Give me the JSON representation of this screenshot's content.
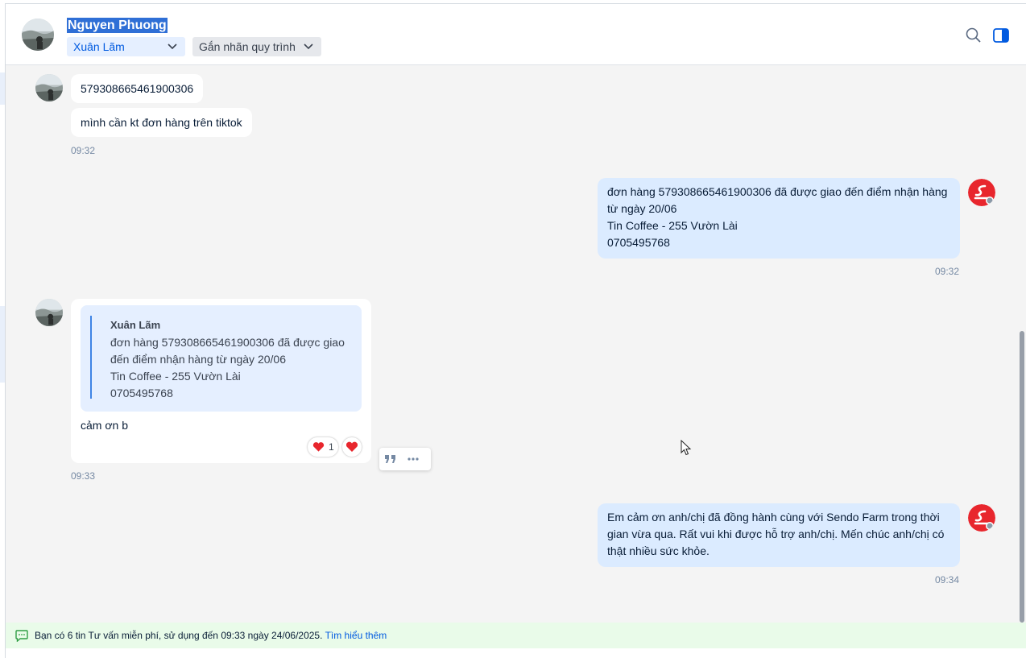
{
  "header": {
    "contact_name": "Nguyen Phuong",
    "assignee": "Xuân Lãm",
    "label_dropdown": "Gắn nhãn quy trình",
    "icons": [
      "search-icon",
      "sidebar-toggle-icon"
    ]
  },
  "messages": {
    "m1_text": "579308665461900306",
    "m2_text": "mình cần kt đơn hàng trên tiktok",
    "m2_time": "09:32",
    "m3_lines": [
      "đơn hàng 579308665461900306 đã được giao đến điểm nhận hàng",
      "từ ngày 20/06",
      "Tin Coffee - 255 Vườn Lài",
      "0705495768"
    ],
    "m3_time": "09:32",
    "m4_quote_author": "Xuân Lãm",
    "m4_quote_lines": [
      "đơn hàng 579308665461900306 đã được giao",
      "đến điểm nhận hàng từ ngày 20/06",
      "Tin Coffee - 255 Vườn Lài",
      "0705495768"
    ],
    "m4_text": "cảm ơn b",
    "m4_reaction_count": "1",
    "m4_time": "09:33",
    "m5_lines": [
      "Em cảm ơn anh/chị đã đồng hành cùng với Sendo Farm trong thời",
      "gian vừa qua. Rất vui khi được hỗ trợ anh/chị. Mến chúc anh/chị có",
      "thật nhiều sức khỏe."
    ],
    "m5_time": "09:34"
  },
  "notice": {
    "text": "Bạn có 6 tin Tư vấn miễn phí, sử dụng đến 09:33 ngày 24/06/2025.",
    "link": "Tìm hiểu thêm"
  },
  "colors": {
    "accent": "#005ae0",
    "my_bubble": "#dbebff",
    "brand_red": "#e8262d",
    "notice_bg": "#e9fbe9"
  }
}
